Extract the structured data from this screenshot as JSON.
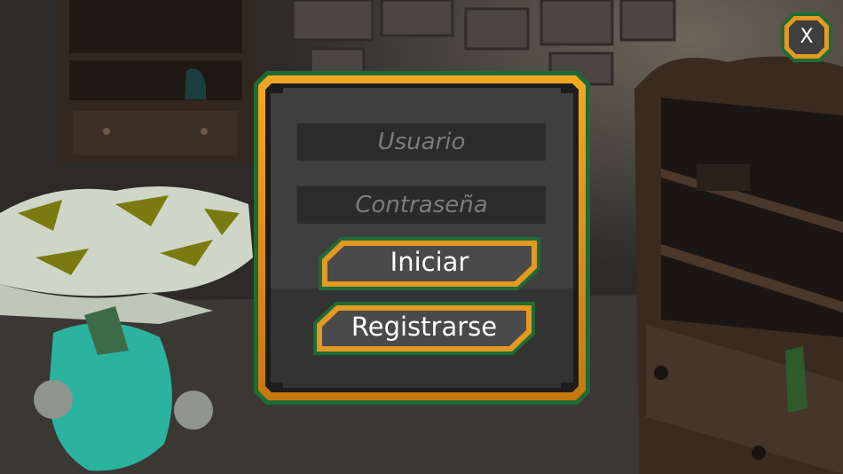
{
  "close_button": {
    "label": "X",
    "icon": "close-icon"
  },
  "login_form": {
    "username": {
      "value": "",
      "placeholder": "Usuario"
    },
    "password": {
      "value": "",
      "placeholder": "Contraseña"
    },
    "login_label": "Iniciar",
    "register_label": "Registrarse"
  },
  "colors": {
    "frame_orange": "#d98c1c",
    "frame_green": "#1e6b35",
    "panel_bg": "#3d3d3d",
    "field_bg": "#2b2b2b",
    "button_fill": "#4a4a4a"
  }
}
